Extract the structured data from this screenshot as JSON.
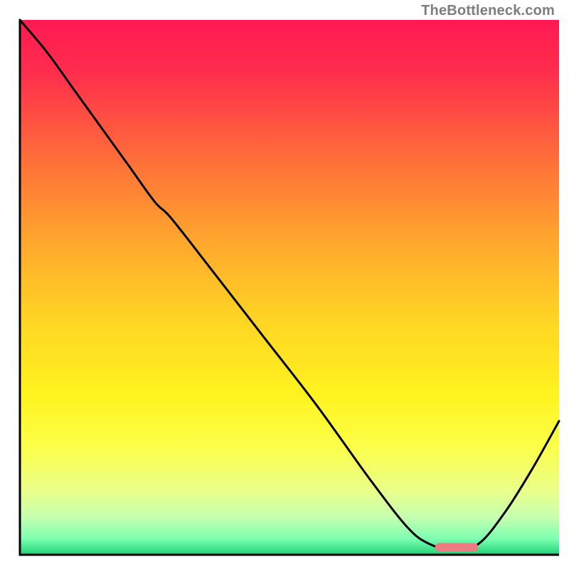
{
  "attribution": "TheBottleneck.com",
  "chart_data": {
    "type": "line",
    "title": "",
    "xlabel": "",
    "ylabel": "",
    "xlim": [
      0,
      100
    ],
    "ylim": [
      0,
      100
    ],
    "grid": false,
    "x": [
      0,
      5,
      10,
      15,
      20,
      25,
      28,
      35,
      45,
      55,
      65,
      72,
      76,
      80,
      85,
      90,
      95,
      100
    ],
    "values": [
      100,
      94,
      87,
      80,
      73,
      66,
      63,
      54,
      41,
      28,
      14,
      5,
      2,
      1,
      2,
      8,
      16,
      25
    ],
    "marker": {
      "x_start": 77,
      "x_end": 85,
      "y": 1.4
    },
    "gradient_stops": [
      {
        "pos": 0.0,
        "color": "#ff1a52"
      },
      {
        "pos": 0.1,
        "color": "#ff2e4d"
      },
      {
        "pos": 0.25,
        "color": "#ff6a3a"
      },
      {
        "pos": 0.4,
        "color": "#ffa22e"
      },
      {
        "pos": 0.55,
        "color": "#ffd224"
      },
      {
        "pos": 0.7,
        "color": "#fff31f"
      },
      {
        "pos": 0.8,
        "color": "#fcff4a"
      },
      {
        "pos": 0.88,
        "color": "#e9ff8a"
      },
      {
        "pos": 0.93,
        "color": "#c6ffb0"
      },
      {
        "pos": 0.97,
        "color": "#7dffb0"
      },
      {
        "pos": 1.0,
        "color": "#1fd17a"
      }
    ]
  }
}
